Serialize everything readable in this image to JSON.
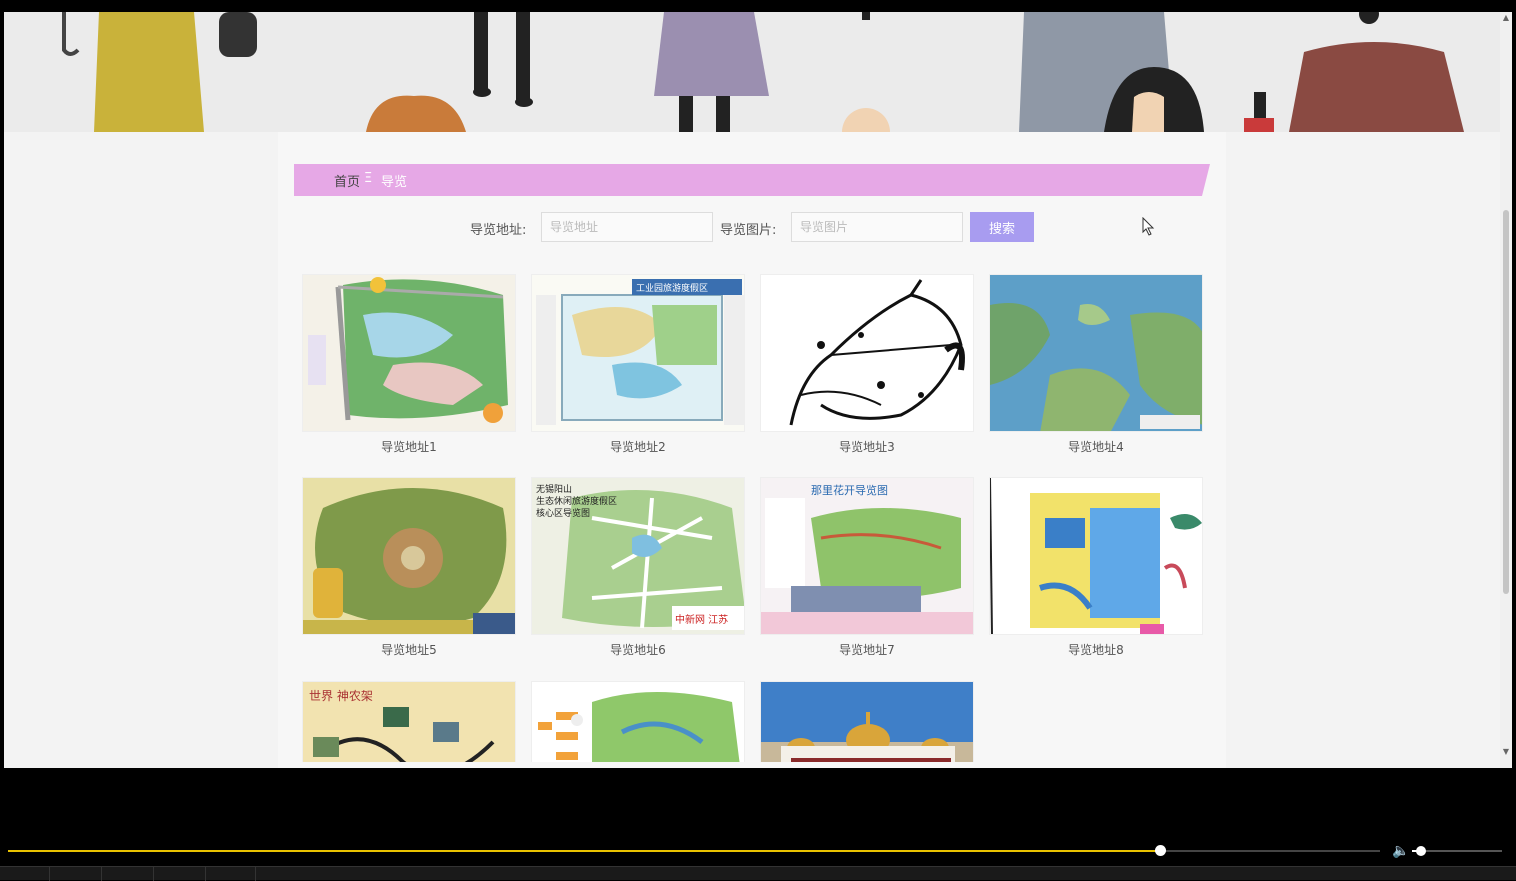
{
  "breadcrumb": {
    "home": "首页",
    "separator": "Ξ",
    "current": "导览"
  },
  "search": {
    "address_label": "导览地址:",
    "address_placeholder": "导览地址",
    "image_label": "导览图片:",
    "image_placeholder": "导览图片",
    "button_label": "搜索"
  },
  "tiles": [
    {
      "caption": "导览地址1"
    },
    {
      "caption": "导览地址2"
    },
    {
      "caption": "导览地址3"
    },
    {
      "caption": "导览地址4"
    },
    {
      "caption": "导览地址5"
    },
    {
      "caption": "导览地址6"
    },
    {
      "caption": "导览地址7"
    },
    {
      "caption": "导览地址8"
    },
    {
      "caption": ""
    },
    {
      "caption": ""
    },
    {
      "caption": ""
    }
  ],
  "map_texts": {
    "t2": "工业园旅游度假区",
    "t6a": "无锡阳山",
    "t6b": "生态休闲旅游度假区",
    "t6c": "核心区导览图",
    "t6d": "中新网 江苏",
    "t7": "那里花开导览图",
    "t9": "世界  神农架"
  },
  "player": {
    "progress": 0.84,
    "volume": 0.1
  },
  "colors": {
    "breadcrumb": "#e6a8e6",
    "button": "#a89cf0",
    "progress": "#e8c200"
  }
}
